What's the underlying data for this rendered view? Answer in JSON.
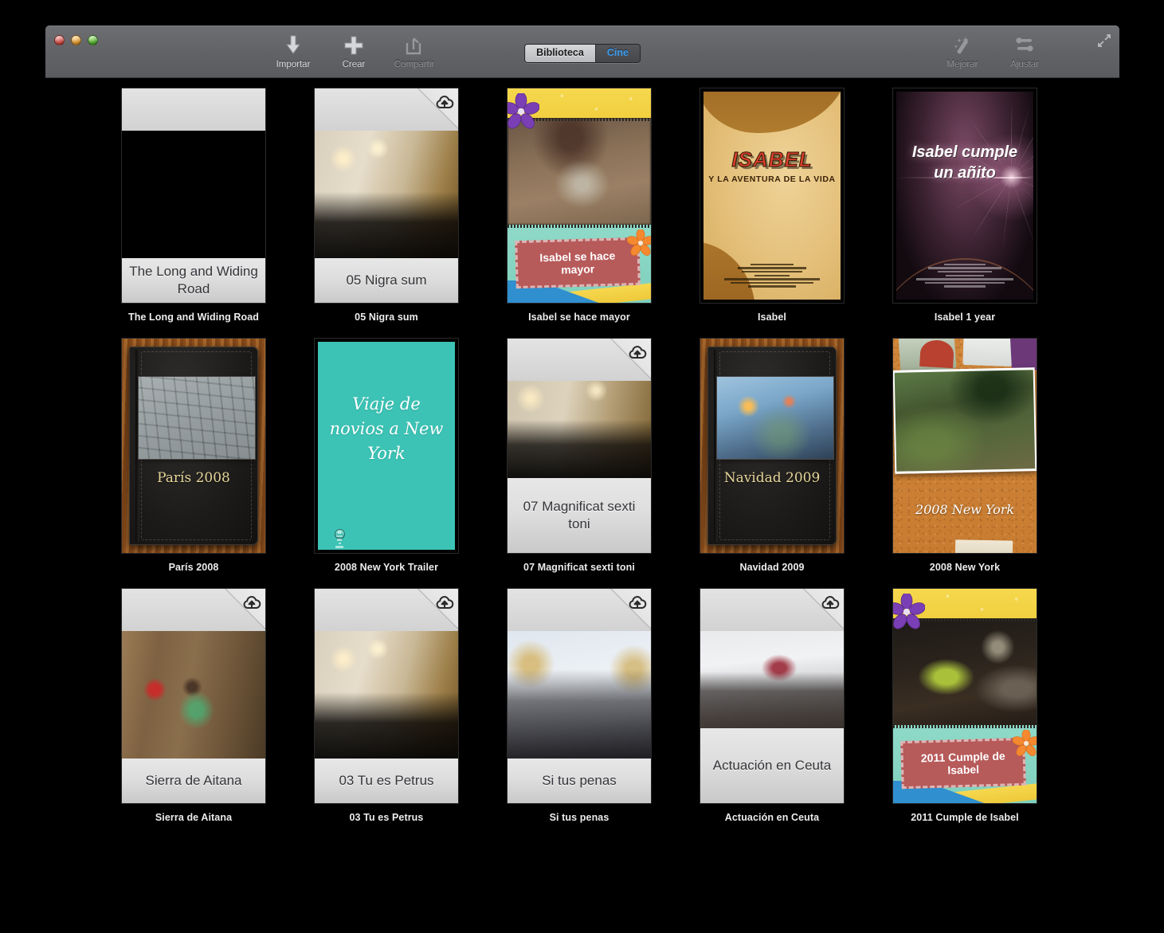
{
  "window": {
    "traffic_lights": [
      "close",
      "minimize",
      "maximize"
    ]
  },
  "toolbar": {
    "left_buttons": [
      {
        "label": "Importar",
        "icon": "download-arrow-icon",
        "enabled": true
      },
      {
        "label": "Crear",
        "icon": "plus-icon",
        "enabled": true
      },
      {
        "label": "Compartir",
        "icon": "share-icon",
        "enabled": false
      }
    ],
    "right_buttons": [
      {
        "label": "Mejorar",
        "icon": "magic-wand-icon",
        "enabled": false
      },
      {
        "label": "Ajustar",
        "icon": "sliders-icon",
        "enabled": false
      }
    ],
    "segmented": {
      "options": [
        "Biblioteca",
        "Cine"
      ],
      "selected": "Biblioteca",
      "accent_color": "#3c9bf0"
    },
    "fullscreen_icon": "expand-arrows-icon"
  },
  "grid": {
    "rows": [
      [
        {
          "caption": "The Long and Widing Road",
          "card_title": "The Long and Widing Road",
          "theme": "standard-black",
          "cloud_badge": false
        },
        {
          "caption": "05 Nigra sum",
          "card_title": "05 Nigra sum",
          "theme": "standard-photo",
          "photo": "ph-church",
          "cloud_badge": true
        },
        {
          "caption": "Isabel se hace mayor",
          "card_title": "Isabel se hace mayor",
          "theme": "scrapbook",
          "photo": "ph-blur",
          "cloud_badge": false
        },
        {
          "caption": "Isabel",
          "card_title": "ISABEL",
          "card_subtitle": "Y LA AVENTURA DE LA VIDA",
          "theme": "adventure-poster",
          "cloud_badge": false
        },
        {
          "caption": "Isabel 1 year",
          "card_title": "Isabel cumple un añito",
          "theme": "flare-poster",
          "cloud_badge": false
        }
      ],
      [
        {
          "caption": "París 2008",
          "card_title": "París 2008",
          "theme": "photo-album",
          "photo": "ph-cobble",
          "cloud_badge": false
        },
        {
          "caption": "2008 New York Trailer",
          "card_title": "Viaje de novios a New York",
          "theme": "teal-poster",
          "cloud_badge": false
        },
        {
          "caption": "07 Magnificat sexti toni",
          "card_title": "07 Magnificat sexti toni",
          "theme": "standard-photo-tall",
          "photo": "ph-church2",
          "cloud_badge": true
        },
        {
          "caption": "Navidad 2009",
          "card_title": "Navidad 2009",
          "theme": "photo-album",
          "photo": "ph-navidad",
          "cloud_badge": false
        },
        {
          "caption": "2008 New York",
          "card_title": "2008 New York",
          "theme": "corkboard",
          "photo": "ph-garden",
          "cloud_badge": false
        }
      ],
      [
        {
          "caption": "Sierra de Aitana",
          "card_title": "Sierra de Aitana",
          "theme": "standard-photo",
          "photo": "ph-street",
          "cloud_badge": true
        },
        {
          "caption": "03 Tu es Petrus",
          "card_title": "03 Tu es Petrus",
          "theme": "standard-photo",
          "photo": "ph-church",
          "cloud_badge": true
        },
        {
          "caption": "Si tus penas",
          "card_title": "Si tus penas",
          "theme": "standard-photo",
          "photo": "ph-choir",
          "cloud_badge": true
        },
        {
          "caption": "Actuación en Ceuta",
          "card_title": "Actuación en Ceuta",
          "theme": "standard-photo-tall",
          "photo": "ph-ceuta",
          "cloud_badge": true
        },
        {
          "caption": "2011 Cumple de Isabel",
          "card_title": "2011 Cumple de Isabel",
          "theme": "scrapbook",
          "photo": "ph-party",
          "cloud_badge": false
        }
      ]
    ]
  }
}
